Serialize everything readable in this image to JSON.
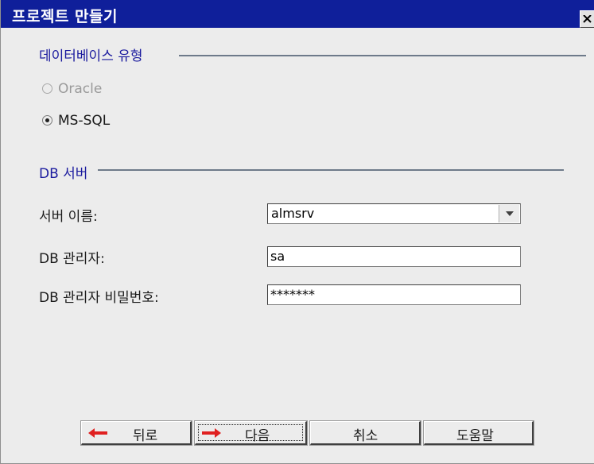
{
  "window": {
    "title": "프로젝트 만들기",
    "close_icon": "close-icon"
  },
  "db_type_section": {
    "title": "데이터베이스 유형",
    "options": [
      {
        "label": "Oracle",
        "selected": false,
        "enabled": false
      },
      {
        "label": "MS-SQL",
        "selected": true,
        "enabled": true
      }
    ]
  },
  "db_server_section": {
    "title": "DB 서버",
    "server_name": {
      "label": "서버 이름:",
      "value": "almsrv"
    },
    "admin": {
      "label": "DB 관리자:",
      "value": "sa"
    },
    "password": {
      "label": "DB 관리자 비밀번호:",
      "value": "*******"
    }
  },
  "buttons": {
    "back": {
      "label": "뒤로",
      "icon": "arrow-left-icon"
    },
    "next": {
      "label": "다음",
      "icon": "arrow-right-icon"
    },
    "cancel": {
      "label": "취소"
    },
    "help": {
      "label": "도움말"
    }
  },
  "colors": {
    "titlebar": "#0f1f9a",
    "section_title": "#1a1a9e",
    "arrow_red": "#e02020",
    "dialog_bg": "#ececec"
  }
}
